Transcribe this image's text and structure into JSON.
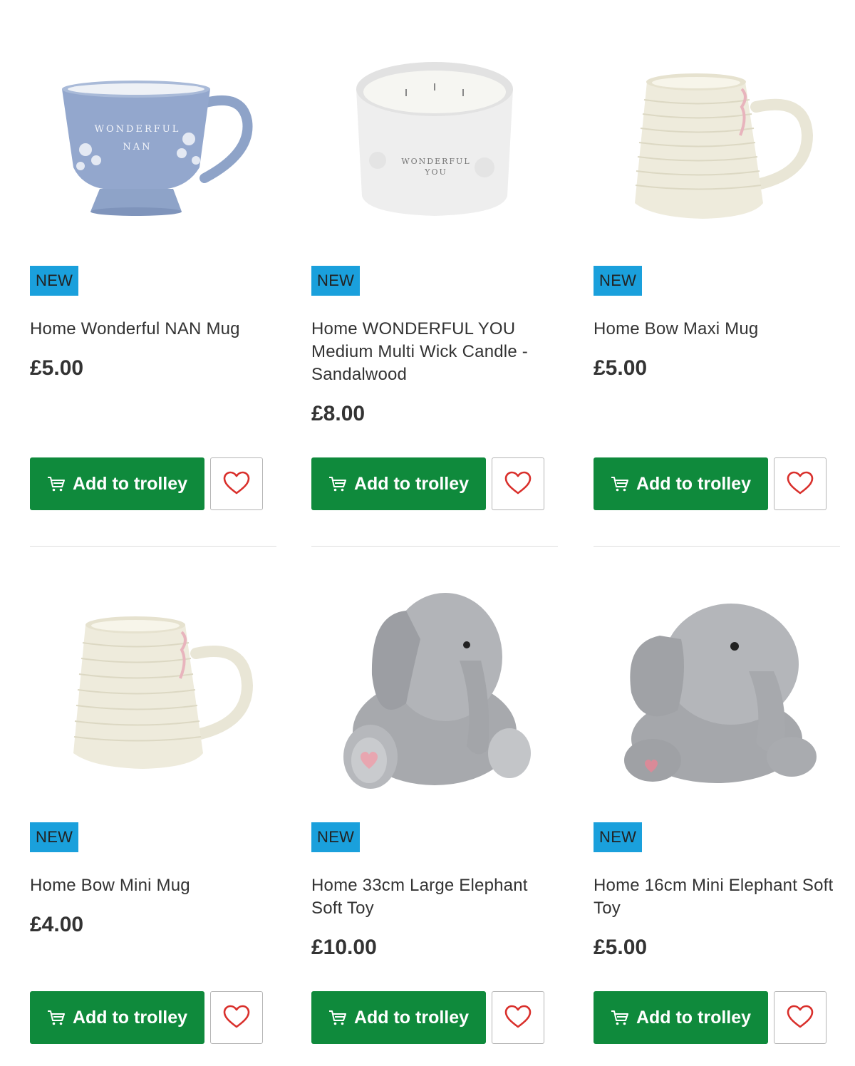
{
  "products": [
    {
      "badge": "NEW",
      "title": "Home Wonderful NAN Mug",
      "price": "£5.00",
      "add_label": "Add to trolley",
      "image": "blue-floral-mug",
      "image_text": "WONDERFUL NAN"
    },
    {
      "badge": "NEW",
      "title": "Home WONDERFUL YOU Medium Multi Wick Candle - Sandalwood",
      "price": "£8.00",
      "add_label": "Add to trolley",
      "image": "white-candle-jar",
      "image_text": "WONDERFUL YOU"
    },
    {
      "badge": "NEW",
      "title": "Home Bow Maxi Mug",
      "price": "£5.00",
      "add_label": "Add to trolley",
      "image": "cream-ribbed-mug"
    },
    {
      "badge": "NEW",
      "title": "Home Bow Mini Mug",
      "price": "£4.00",
      "add_label": "Add to trolley",
      "image": "cream-ribbed-mug"
    },
    {
      "badge": "NEW",
      "title": "Home 33cm Large Elephant Soft Toy",
      "price": "£10.00",
      "add_label": "Add to trolley",
      "image": "grey-elephant-toy"
    },
    {
      "badge": "NEW",
      "title": "Home 16cm Mini Elephant Soft Toy",
      "price": "£5.00",
      "add_label": "Add to trolley",
      "image": "grey-elephant-toy"
    }
  ],
  "colors": {
    "badge": "#1aa0dc",
    "button": "#0f8a3c",
    "heart": "#d9302c"
  },
  "icons": {
    "cart": "trolley-icon",
    "favourite": "heart-icon"
  }
}
